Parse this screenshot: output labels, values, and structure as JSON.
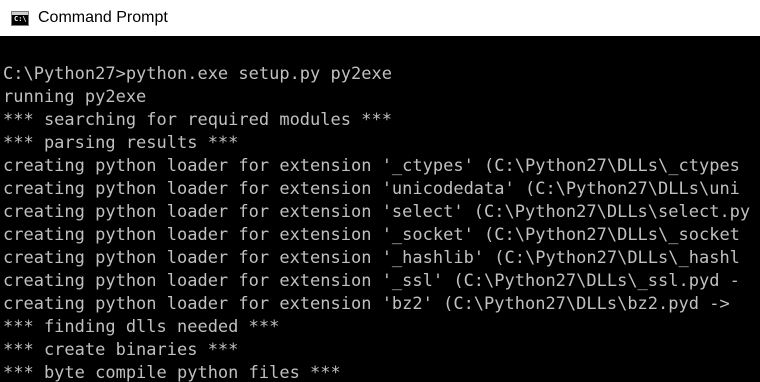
{
  "window": {
    "title": "Command Prompt",
    "icon": "cmd-console-icon",
    "icon_glyph": "C:\\"
  },
  "colors": {
    "terminal_background": "#000000",
    "terminal_text": "#c0c0c0",
    "titlebar_background": "#ffffff"
  },
  "terminal": {
    "lines": [
      "C:\\Python27>python.exe setup.py py2exe",
      "running py2exe",
      "*** searching for required modules ***",
      "*** parsing results ***",
      "creating python loader for extension '_ctypes' (C:\\Python27\\DLLs\\_ctypes",
      "creating python loader for extension 'unicodedata' (C:\\Python27\\DLLs\\uni",
      "creating python loader for extension 'select' (C:\\Python27\\DLLs\\select.py",
      "creating python loader for extension '_socket' (C:\\Python27\\DLLs\\_socket",
      "creating python loader for extension '_hashlib' (C:\\Python27\\DLLs\\_hashl",
      "creating python loader for extension '_ssl' (C:\\Python27\\DLLs\\_ssl.pyd -",
      "creating python loader for extension 'bz2' (C:\\Python27\\DLLs\\bz2.pyd -> ",
      "*** finding dlls needed ***",
      "*** create binaries ***",
      "*** byte compile python files ***"
    ]
  }
}
